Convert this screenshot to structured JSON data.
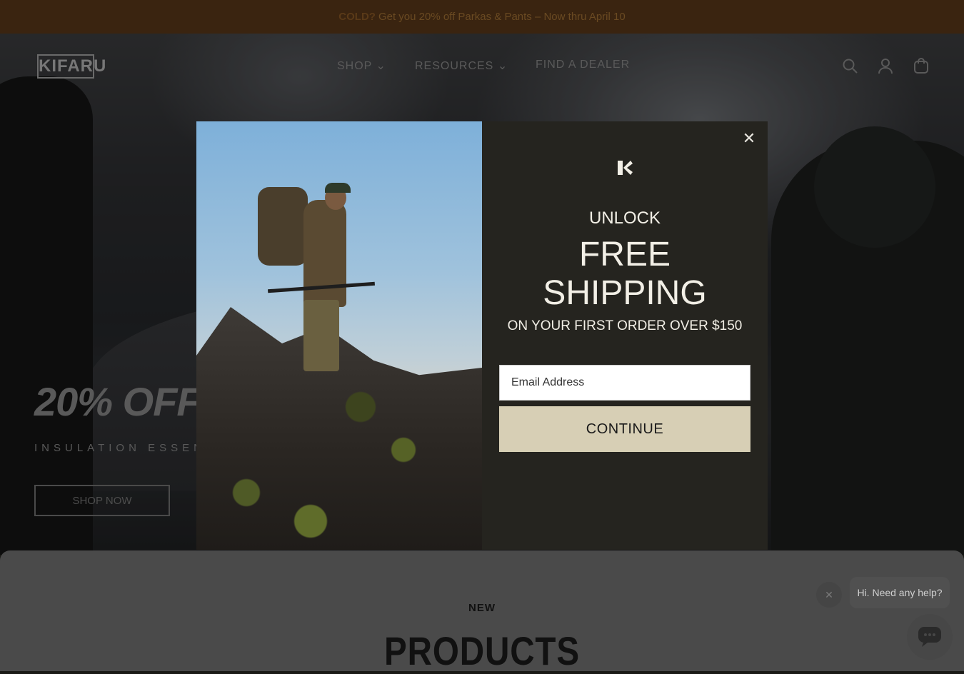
{
  "announcement": {
    "bold": "COLD?",
    "text": "Get you 20% off Parkas & Pants – Now thru April 10"
  },
  "nav": {
    "logo": "KIFARU",
    "items": [
      {
        "label": "SHOP"
      },
      {
        "label": "RESOURCES"
      },
      {
        "label": "FIND A DEALER"
      }
    ]
  },
  "hero": {
    "title": "20% OFF",
    "subtitle": "INSULATION ESSENTIALS",
    "cta": "SHOP NOW"
  },
  "modal": {
    "unlock": "UNLOCK",
    "headline_line1": "FREE",
    "headline_line2": "SHIPPING",
    "offer": "ON YOUR FIRST ORDER OVER $150",
    "email_placeholder": "Email Address",
    "continue_label": "CONTINUE"
  },
  "products": {
    "eyebrow": "NEW",
    "title": "PRODUCTS"
  },
  "chat": {
    "bubble": "Hi. Need any help?"
  }
}
